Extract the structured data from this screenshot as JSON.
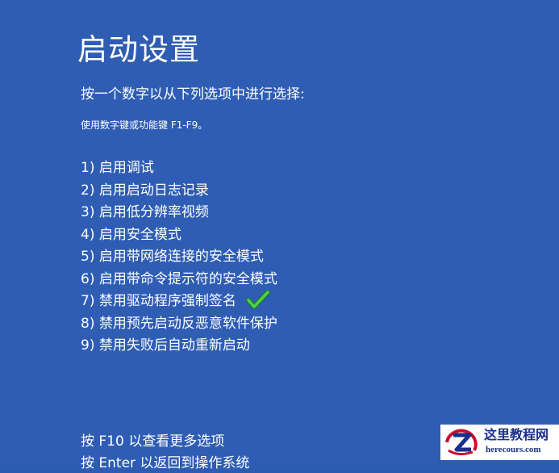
{
  "header": {
    "title": "启动设置",
    "instruction": "按一个数字以从下列选项中进行选择:",
    "hint": "使用数字键或功能键 F1-F9。"
  },
  "options": [
    {
      "label": "1) 启用调试"
    },
    {
      "label": "2) 启用启动日志记录"
    },
    {
      "label": "3) 启用低分辨率视频"
    },
    {
      "label": "4) 启用安全模式"
    },
    {
      "label": "5) 启用带网络连接的安全模式"
    },
    {
      "label": "6) 启用带命令提示符的安全模式"
    },
    {
      "label": "7) 禁用驱动程序强制签名",
      "marked": true
    },
    {
      "label": "8) 禁用预先启动反恶意软件保护"
    },
    {
      "label": "9) 禁用失败后自动重新启动"
    }
  ],
  "footer": {
    "more_options": "按 F10 以查看更多选项",
    "return": "按 Enter 以返回到操作系统"
  },
  "watermark": {
    "name": "这里教程网",
    "url": "herecours.com"
  },
  "colors": {
    "background": "#2f5db4",
    "text": "#ffffff",
    "check": "#3fbf3a",
    "watermark_text": "#1a2f8a"
  }
}
